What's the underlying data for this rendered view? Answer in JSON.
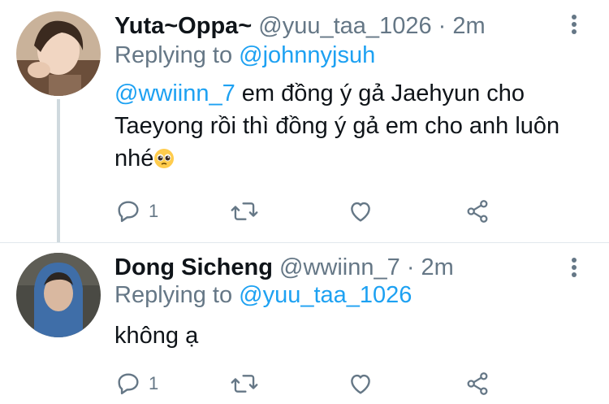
{
  "colors": {
    "link": "#1da1f2",
    "secondary_text": "#657786",
    "primary_text": "#0f1419",
    "thread_line": "#cfd9de"
  },
  "tweets": [
    {
      "display_name": "Yuta~Oppa~",
      "handle": "@yuu_taa_1026",
      "separator": "·",
      "time": "2m",
      "replying_prefix": "Replying to",
      "replying_to": "@johnnyjsuh",
      "text_mention": "@wwiinn_7",
      "text_body": "em đồng ý gả Jaehyun cho Taeyong rồi thì đồng ý gả em cho anh luôn nhé",
      "emoji": "pleading-face-emoji",
      "reply_count": "1",
      "avatar": "avatar-photo"
    },
    {
      "display_name": "Dong Sicheng",
      "handle": "@wwiinn_7",
      "separator": "·",
      "time": "2m",
      "replying_prefix": "Replying to",
      "replying_to": "@yuu_taa_1026",
      "text_body": "không ạ",
      "reply_count": "1",
      "avatar": "avatar-photo"
    }
  ],
  "icons": [
    "reply-icon",
    "retweet-icon",
    "like-icon",
    "share-icon",
    "more-options-icon"
  ]
}
